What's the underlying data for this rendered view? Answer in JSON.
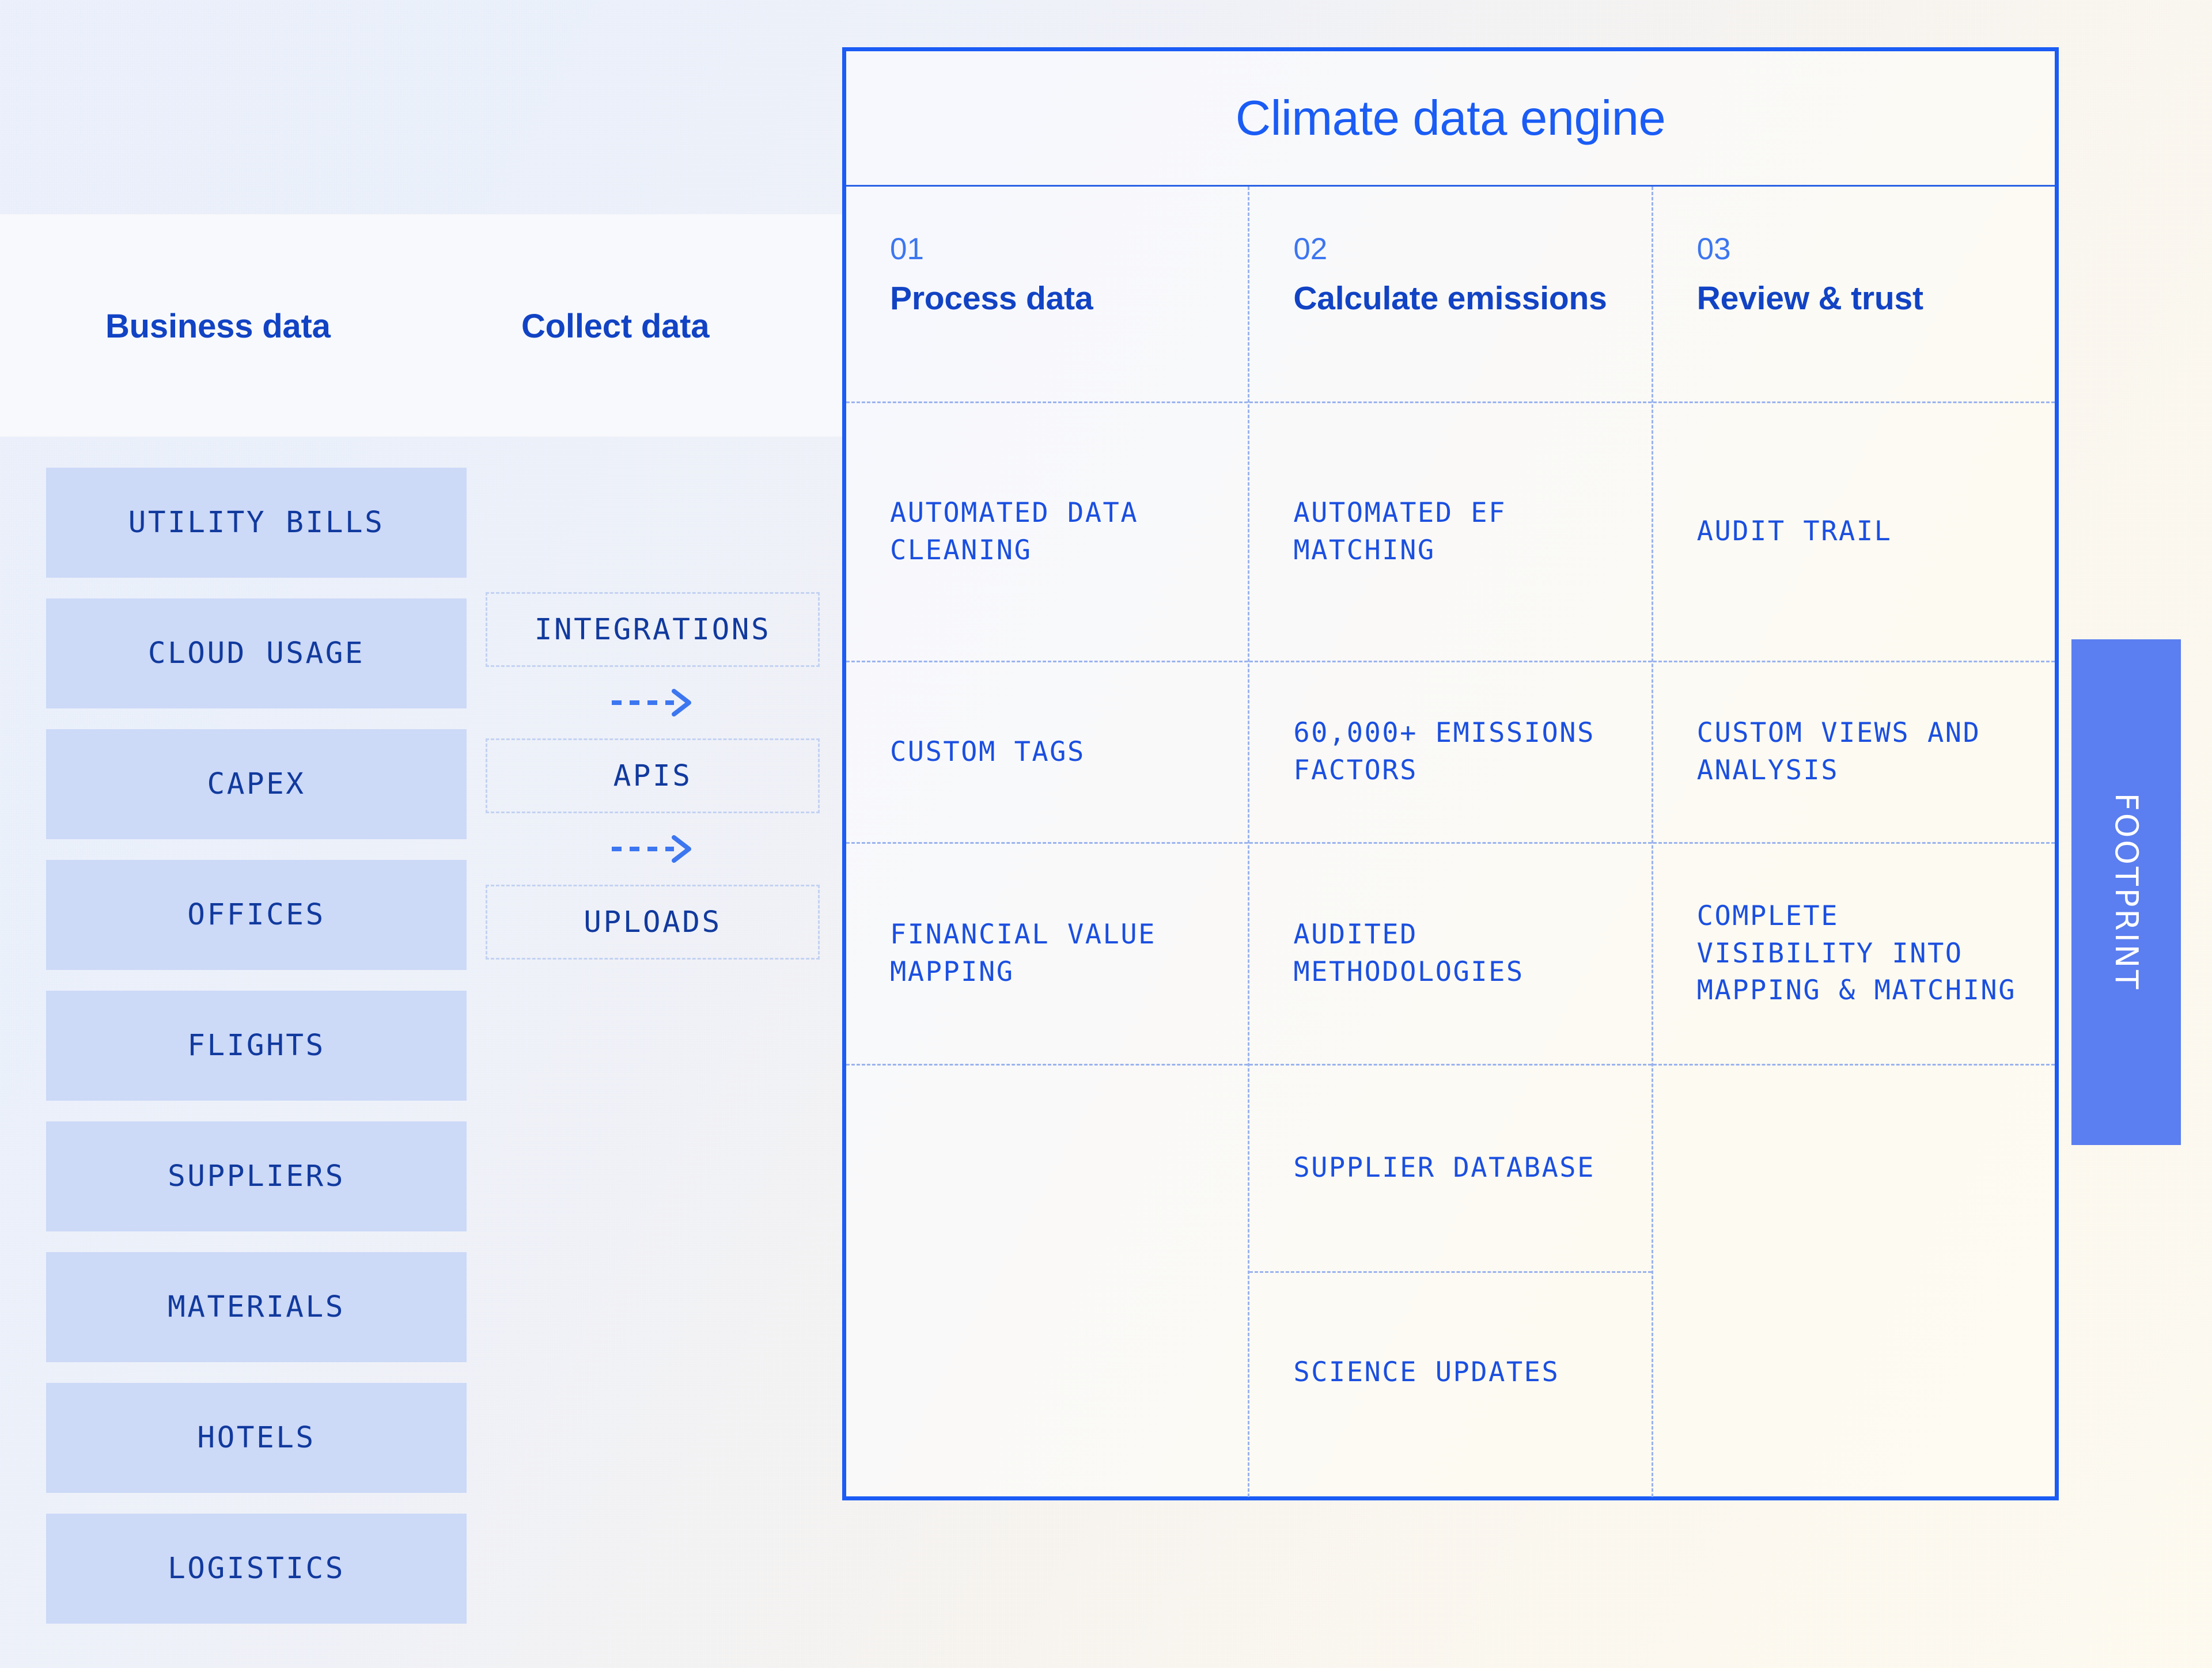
{
  "left_panel": {
    "business_heading": "Business data",
    "collect_heading": "Collect data",
    "business_items": [
      {
        "label": "UTILITY BILLS"
      },
      {
        "label": "CLOUD USAGE"
      },
      {
        "label": "CAPEX"
      },
      {
        "label": "OFFICES"
      },
      {
        "label": "FLIGHTS"
      },
      {
        "label": "SUPPLIERS"
      },
      {
        "label": "MATERIALS"
      },
      {
        "label": "HOTELS"
      },
      {
        "label": "LOGISTICS"
      }
    ],
    "collect_items": [
      {
        "label": "INTEGRATIONS"
      },
      {
        "label": "APIS"
      },
      {
        "label": "UPLOADS"
      }
    ],
    "arrow_icon": "dashed-arrow-right-icon"
  },
  "engine": {
    "title": "Climate data engine",
    "columns": [
      {
        "number": "01",
        "title": "Process data",
        "cells": [
          "AUTOMATED DATA CLEANING",
          "CUSTOM TAGS",
          "FINANCIAL VALUE MAPPING",
          "",
          ""
        ]
      },
      {
        "number": "02",
        "title": "Calculate emissions",
        "cells": [
          "AUTOMATED EF MATCHING",
          "60,000+ EMISSIONS FACTORS",
          "AUDITED METHODOLOGIES",
          "SUPPLIER DATABASE",
          "SCIENCE UPDATES"
        ]
      },
      {
        "number": "03",
        "title": "Review & trust",
        "cells": [
          "AUDIT TRAIL",
          "CUSTOM VIEWS AND ANALYSIS",
          "COMPLETE VISIBILITY INTO MAPPING & MATCHING",
          "",
          ""
        ]
      }
    ]
  },
  "footprint": {
    "label": "FOOTPRINT"
  },
  "colors": {
    "accent_blue": "#1a5cf5",
    "deep_blue": "#1143c4",
    "mono_blue": "#1a4fe0",
    "chip_blue": "#ccd9f7",
    "badge_blue": "#5b7ef0",
    "dashed_blue": "#9ab3ef",
    "page_bg_left": "#e9eefb",
    "page_bg_right": "#fdf9ef"
  }
}
